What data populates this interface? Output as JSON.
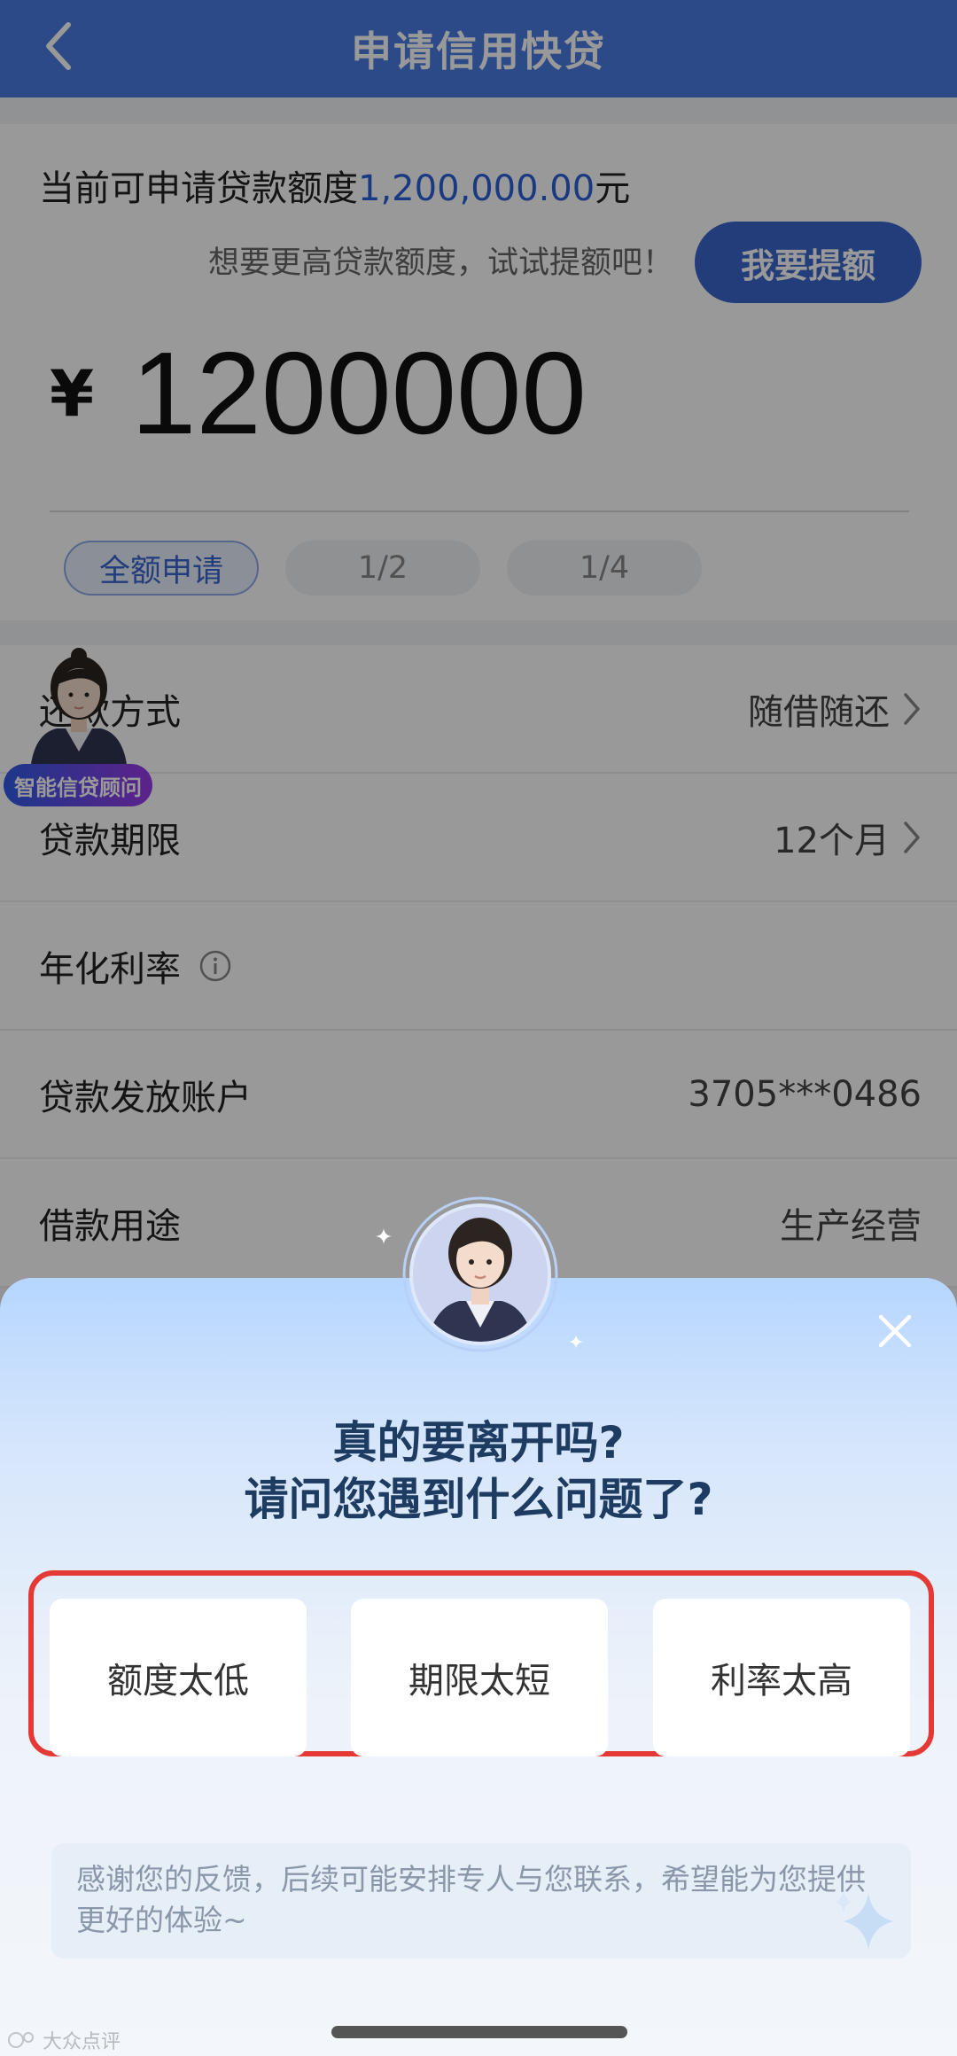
{
  "header": {
    "title": "申请信用快贷",
    "back_icon": "chevron-left-icon"
  },
  "amount_card": {
    "quota_prefix": "当前可申请贷款额度",
    "quota_value": "1,200,000.00",
    "quota_suffix": "元",
    "raise_tip": "想要更高贷款额度，试试提额吧！",
    "raise_button": "我要提额",
    "currency_symbol": "¥",
    "amount": "1200000",
    "ratio_options": [
      {
        "label": "全额申请",
        "selected": true
      },
      {
        "label": "1/2",
        "selected": false
      },
      {
        "label": "1/4",
        "selected": false
      }
    ]
  },
  "form": {
    "rows": [
      {
        "label": "还款方式",
        "value": "随借随还"
      },
      {
        "label": "贷款期限",
        "value": "12个月"
      },
      {
        "label": "年化利率",
        "value": ""
      },
      {
        "label": "贷款发放账户",
        "value": "3705***0486"
      },
      {
        "label": "借款用途",
        "value": "生产经营"
      }
    ]
  },
  "advisor": {
    "badge": "智能信贷顾问",
    "icon": "advisor-avatar-icon"
  },
  "sheet": {
    "title_line1": "真的要离开吗?",
    "title_line2": "请问您遇到什么问题了?",
    "options": [
      "额度太低",
      "期限太短",
      "利率太高"
    ],
    "feedback_note": "感谢您的反馈，后续可能安排专人与您联系，希望能为您提供更好的体验~",
    "close_icon": "close-icon"
  },
  "watermark": "大众点评",
  "colors": {
    "brand_blue": "#4a7ce3",
    "highlight_frame": "#e53935",
    "title_navy": "#1e3c62"
  }
}
